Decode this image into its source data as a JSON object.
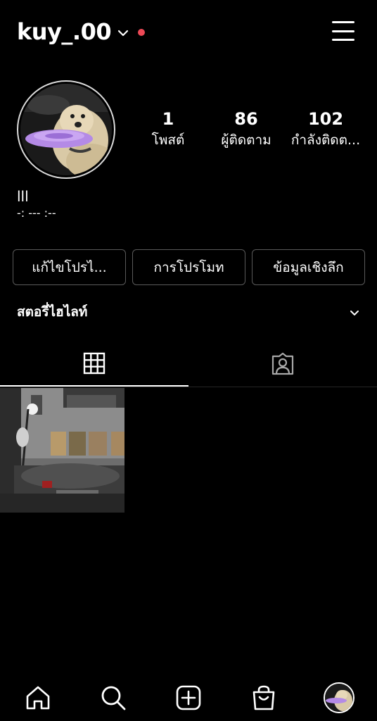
{
  "header": {
    "username": "kuy_.00"
  },
  "stats": {
    "posts": {
      "count": "1",
      "label": "โพสต์"
    },
    "followers": {
      "count": "86",
      "label": "ผู้ติดตาม"
    },
    "following": {
      "count": "102",
      "label": "กำลังติดต..."
    }
  },
  "bio": {
    "name": "lll",
    "line": "-: --- :--"
  },
  "buttons": {
    "edit_profile": "แก้ไขโปรไ...",
    "promotions": "การโปรโมท",
    "insights": "ข้อมูลเชิงลึก"
  },
  "highlights": {
    "title": "สตอรี่ไฮไลท์"
  },
  "icons": {
    "dropdown": "chevron-down-icon",
    "menu": "hamburger-icon",
    "grid_tab": "grid-icon",
    "tagged_tab": "tagged-person-icon",
    "home": "home-icon",
    "search": "search-icon",
    "create": "plus-square-icon",
    "shop": "shopping-bag-icon"
  },
  "colors": {
    "background": "#000000",
    "live_dot": "#ed4956",
    "button_border": "#5a5a5a"
  }
}
